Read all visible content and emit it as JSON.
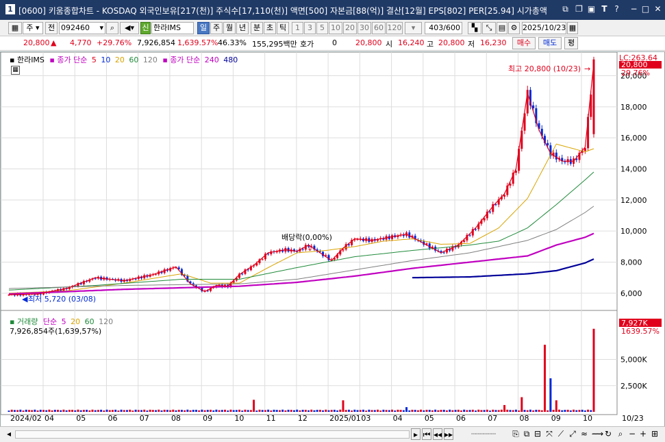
{
  "window": {
    "screen_no": "1",
    "title": "[0600] 키움종합차트 - KOSDAQ 외국인보유[217(천)] 주식수[17,110(천)] 액면[500] 자본금[88(억)] 결산[12월] EPS[802] PER[25.94] 시가총액"
  },
  "toolbar": {
    "type_value": "주",
    "prev_label": "전",
    "code_value": "092460",
    "credit_badge": "신",
    "stock_name": "한라IMS",
    "period_tabs": [
      "일",
      "주",
      "월",
      "년",
      "분",
      "초",
      "틱"
    ],
    "interval_options": [
      "1",
      "3",
      "5",
      "10",
      "20",
      "30",
      "60",
      "120"
    ],
    "count_value": "403",
    "count_total": "/600",
    "date_value": "2025/10/23"
  },
  "quote": {
    "price": "20,800",
    "change": "4,770",
    "change_pct": "+29.76%",
    "volume": "7,926,854",
    "volume_ratio": "1,639.57%",
    "turnover": "46.33%",
    "amount": "155,295백만",
    "hoga_label": "호가",
    "hoga_value": "0",
    "hoga_price": "20,800",
    "open_label": "시",
    "open": "16,240",
    "high_label": "고",
    "high": "20,800",
    "low_label": "저",
    "low": "16,230",
    "buy_label": "매수",
    "sell_label": "매도",
    "avg_label": "평"
  },
  "price_panel": {
    "stock_legend": "한라IMS",
    "ma_legend_prefix": "종가 단순",
    "ma_legend": [
      {
        "label": "5",
        "color": "#e0001b"
      },
      {
        "label": "10",
        "color": "#0029d6"
      },
      {
        "label": "20",
        "color": "#d9a400"
      },
      {
        "label": "60",
        "color": "#1f8a3a"
      },
      {
        "label": "120",
        "color": "#7f7f7f"
      }
    ],
    "ma_legend2_prefix": "종가 단순",
    "ma_legend2": [
      {
        "label": "240",
        "color": "#c000c0"
      },
      {
        "label": "480",
        "color": "#000099"
      }
    ],
    "high_annotation": "최고 20,800 (10/23)",
    "low_annotation": "최저 5,720 (03/08)",
    "event_annotation": "배당락(0,00%)",
    "last_price_tag": "20,800",
    "last_pct_tag": "29.76%",
    "lc_tag": "LC:263.64"
  },
  "volume_panel": {
    "legend_title": "거래량",
    "ma_prefix": "단순",
    "ma_legend": [
      {
        "label": "5",
        "color": "#c000c0"
      },
      {
        "label": "20",
        "color": "#d9a400"
      },
      {
        "label": "60",
        "color": "#1f8a3a"
      },
      {
        "label": "120",
        "color": "#7f7f7f"
      }
    ],
    "current_volume": "7,926,854주(1,639,57%)",
    "volume_tag": "7,927K",
    "volume_pct_tag": "1639.57%"
  },
  "colors": {
    "up": "#e0001b",
    "down": "#0029d6",
    "ma5": "#e0001b",
    "ma10": "#0029d6",
    "ma20": "#d9a400",
    "ma60": "#1f8a3a",
    "ma120": "#7f7f7f",
    "ma240": "#c000c0",
    "ma480": "#000099"
  },
  "chart_data": [
    {
      "type": "line",
      "title": "",
      "x_ticks": [
        "2024/02",
        "04",
        "05",
        "06",
        "07",
        "08",
        "09",
        "10",
        "11",
        "12",
        "2025/01",
        "03",
        "04",
        "05",
        "06",
        "07",
        "08",
        "09",
        "10",
        "10/23"
      ],
      "ylim": [
        5200,
        21300
      ],
      "y_ticks": [
        "6,000",
        "8,000",
        "10,000",
        "12,000",
        "14,000",
        "16,000",
        "18,000",
        "20,000"
      ],
      "series": [
        {
          "name": "5",
          "x": [
            0,
            10,
            20,
            30,
            40,
            50,
            58,
            63,
            68,
            72,
            76,
            80,
            85,
            90,
            96,
            100,
            104,
            108,
            112,
            116,
            120,
            126,
            132,
            138,
            144,
            150,
            156,
            162,
            168,
            172,
            176,
            180,
            184,
            188,
            192,
            196,
            200,
            203
          ],
          "values": [
            5900,
            5950,
            6300,
            7000,
            6800,
            7200,
            7700,
            6600,
            6100,
            6500,
            6450,
            7200,
            7800,
            8600,
            8800,
            8700,
            9100,
            8600,
            8100,
            8900,
            9500,
            9400,
            9600,
            9800,
            9200,
            8600,
            9100,
            10200,
            11600,
            12400,
            14000,
            18900,
            16500,
            15000,
            14500,
            14500,
            15400,
            20800
          ]
        },
        {
          "name": "20",
          "x": [
            0,
            20,
            40,
            60,
            70,
            80,
            90,
            100,
            110,
            120,
            130,
            140,
            150,
            160,
            170,
            180,
            190,
            200,
            203
          ],
          "values": [
            6000,
            6150,
            6650,
            7250,
            6650,
            6650,
            7650,
            8600,
            8750,
            9000,
            9350,
            9500,
            9150,
            9200,
            10200,
            12100,
            15600,
            15100,
            15300
          ]
        },
        {
          "name": "60",
          "x": [
            0,
            30,
            60,
            80,
            100,
            120,
            140,
            160,
            170,
            180,
            190,
            200,
            203
          ],
          "values": [
            6200,
            6500,
            6900,
            6900,
            7650,
            8350,
            8750,
            9100,
            9350,
            10200,
            11700,
            13300,
            13800
          ]
        },
        {
          "name": "120",
          "x": [
            0,
            40,
            80,
            100,
            120,
            140,
            160,
            180,
            190,
            200,
            203
          ],
          "values": [
            6300,
            6500,
            6600,
            6900,
            7500,
            8100,
            8600,
            9400,
            10100,
            11200,
            11600
          ]
        },
        {
          "name": "240",
          "x": [
            0,
            40,
            80,
            100,
            120,
            140,
            160,
            180,
            190,
            200,
            203
          ],
          "values": [
            5950,
            6250,
            6450,
            6700,
            7100,
            7600,
            8000,
            8400,
            9100,
            9600,
            9850
          ]
        },
        {
          "name": "480",
          "x": [
            140,
            160,
            180,
            190,
            200,
            203
          ],
          "values": [
            7000,
            7050,
            7250,
            7450,
            7950,
            8200
          ]
        }
      ]
    },
    {
      "type": "bar",
      "title": "",
      "ylim": [
        0,
        8500000
      ],
      "y_ticks": [
        "2,500K",
        "5,000K"
      ],
      "bars": [
        {
          "x": 85,
          "value": 1150000,
          "up": true
        },
        {
          "x": 116,
          "value": 1100000,
          "up": true
        },
        {
          "x": 138,
          "value": 450000,
          "up": false
        },
        {
          "x": 172,
          "value": 650000,
          "up": true
        },
        {
          "x": 178,
          "value": 1400000,
          "up": true
        },
        {
          "x": 186,
          "value": 6400000,
          "up": true
        },
        {
          "x": 188,
          "value": 3200000,
          "up": false
        },
        {
          "x": 190,
          "value": 1100000,
          "up": true
        },
        {
          "x": 203,
          "value": 7926854,
          "up": true
        }
      ]
    }
  ]
}
